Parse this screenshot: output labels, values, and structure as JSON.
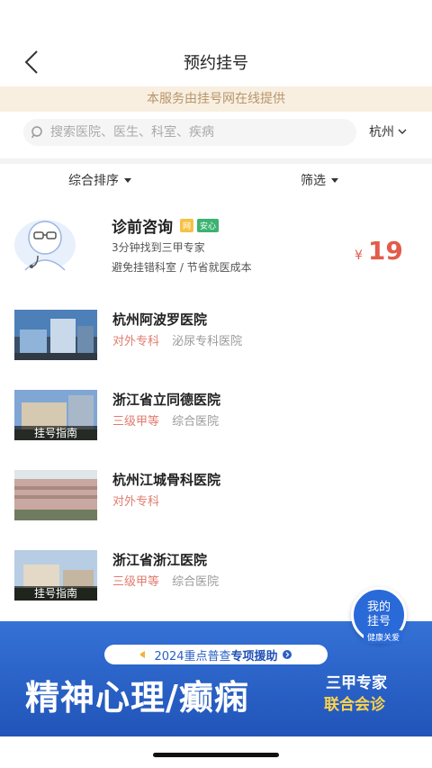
{
  "header": {
    "title": "预约挂号",
    "back_icon": "chevron-left-icon"
  },
  "notice": "本服务由挂号网在线提供",
  "search": {
    "placeholder": "搜索医院、医生、科室、疾病",
    "city": "杭州"
  },
  "sort": {
    "comprehensive": "综合排序",
    "filter": "筛选"
  },
  "consult": {
    "title": "诊前咨询",
    "tag1": "网",
    "tag2": "安心",
    "line1": "3分钟找到三甲专家",
    "line2": "避免挂错科室 / 节省就医成本",
    "currency": "¥",
    "price": "19"
  },
  "hospitals": [
    {
      "name": "杭州阿波罗医院",
      "level": "对外专科",
      "type": "泌尿专科医院",
      "guide": ""
    },
    {
      "name": "浙江省立同德医院",
      "level": "三级甲等",
      "type": "综合医院",
      "guide": "挂号指南"
    },
    {
      "name": "杭州江城骨科医院",
      "level": "对外专科",
      "type": "",
      "guide": ""
    },
    {
      "name": "浙江省浙江医院",
      "level": "三级甲等",
      "type": "综合医院",
      "guide": "挂号指南"
    }
  ],
  "fab": {
    "line1": "我的",
    "line2": "挂号",
    "brand": "健康关爱"
  },
  "banner": {
    "pill_prefix": "2024重点普查",
    "pill_highlight": "专项援助",
    "main": "精神心理/癫痫",
    "side1": "三甲专家",
    "side2": "联合会诊"
  },
  "colors": {
    "accent_red": "#e25c4a",
    "banner_blue": "#2a63cf",
    "notice_bg": "#f8efe1"
  }
}
